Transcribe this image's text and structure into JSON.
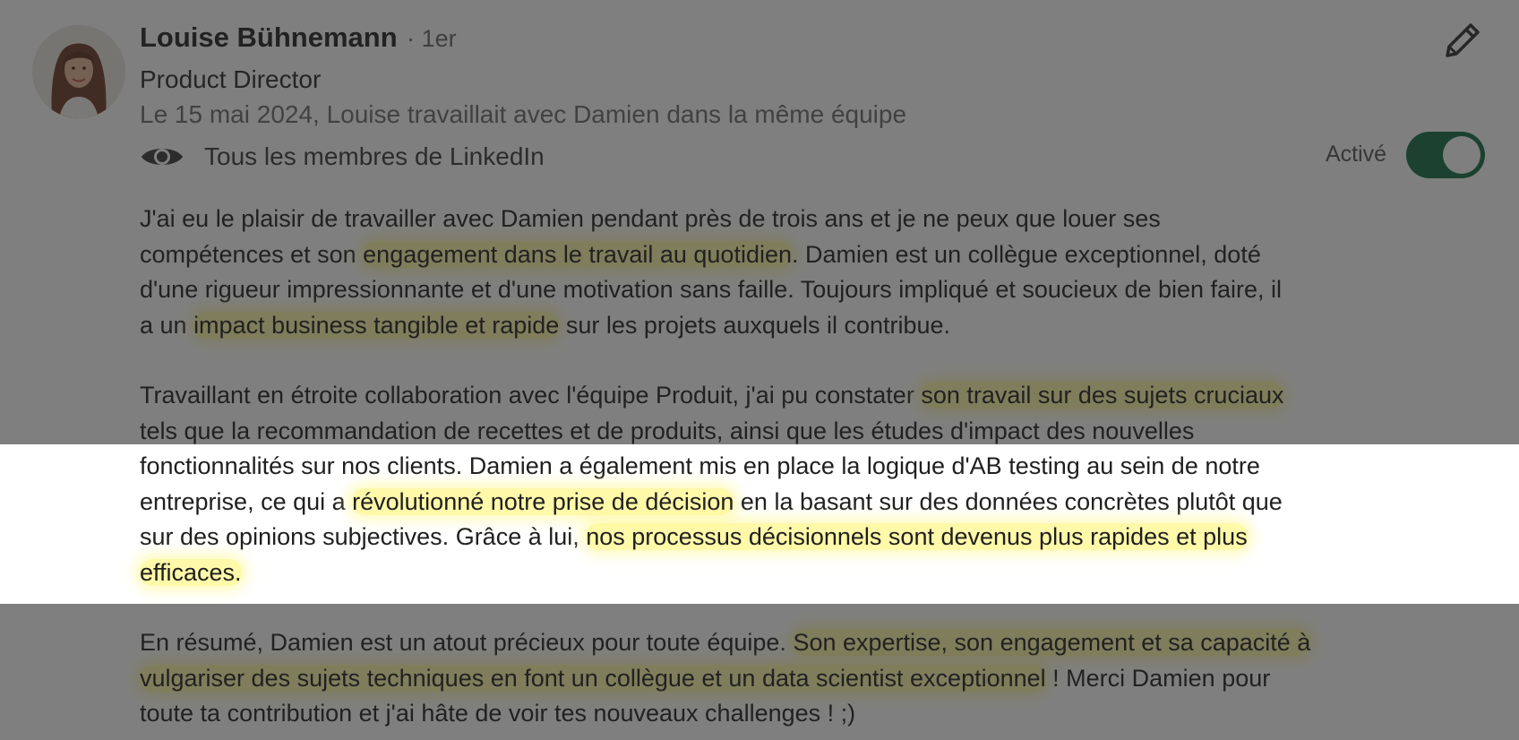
{
  "recommendation": {
    "author": {
      "name": "Louise Bühnemann",
      "degree": "· 1er",
      "headline": "Product Director",
      "relation": "Le 15 mai 2024, Louise travaillait avec Damien dans la même équipe"
    },
    "visibility": {
      "icon": "eye-icon",
      "label": "Tous les membres de LinkedIn"
    },
    "toggle": {
      "label": "Activé",
      "state": "on",
      "color": "#146c43"
    },
    "edit_icon": "pencil-icon",
    "paragraphs": [
      {
        "lines": [
          [
            {
              "t": "J'ai eu le plaisir de travailler avec Damien pendant près de trois ans et je ne peux que louer ses",
              "h": false
            }
          ],
          [
            {
              "t": "compétences et son ",
              "h": false
            },
            {
              "t": "engagement dans le travail au quotidien",
              "h": true
            },
            {
              "t": ". Damien est un collègue exceptionnel, doté",
              "h": false
            }
          ],
          [
            {
              "t": "d'une rigueur impressionnante et d'une motivation sans faille. Toujours impliqué et soucieux de bien faire, il",
              "h": false
            }
          ],
          [
            {
              "t": "a un ",
              "h": false
            },
            {
              "t": "impact business tangible et rapide",
              "h": true
            },
            {
              "t": " sur les projets auxquels il contribue.",
              "h": false
            }
          ]
        ]
      },
      {
        "lines": [
          [
            {
              "t": "Travaillant en étroite collaboration avec l'équipe Produit, j'ai pu constater ",
              "h": false
            },
            {
              "t": "son travail sur des sujets cruciaux",
              "h": true
            }
          ],
          [
            {
              "t": "tels que la recommandation de recettes et de produits, ainsi que les études d'impact des nouvelles",
              "h": false
            }
          ],
          [
            {
              "t": "fonctionnalités sur nos clients. Damien a également mis en place la logique d'AB testing au sein de notre",
              "h": false
            }
          ],
          [
            {
              "t": "entreprise, ce qui a ",
              "h": false
            },
            {
              "t": "révolutionné notre prise de décision",
              "h": true
            },
            {
              "t": " en la basant sur des données concrètes plutôt que",
              "h": false
            }
          ],
          [
            {
              "t": "sur des opinions subjectives. Grâce à lui, ",
              "h": false
            },
            {
              "t": "nos processus décisionnels sont devenus plus rapides et plus",
              "h": true
            }
          ],
          [
            {
              "t": "efficaces.",
              "h": true
            }
          ]
        ]
      },
      {
        "lines": [
          [
            {
              "t": "En résumé, Damien est un atout précieux pour toute équipe. ",
              "h": false
            },
            {
              "t": "Son expertise, son engagement et sa capacité à",
              "h": true
            }
          ],
          [
            {
              "t": "vulgariser des sujets techniques en font un collègue et un data scientist exceptionnel",
              "h": true
            },
            {
              "t": " ! Merci Damien pour",
              "h": false
            }
          ],
          [
            {
              "t": "toute ta contribution et j'ai hâte de voir tes nouveaux challenges ! ;)",
              "h": false
            }
          ]
        ]
      }
    ],
    "highlight_color": "#fff78c",
    "overlay_color": "#222222"
  }
}
